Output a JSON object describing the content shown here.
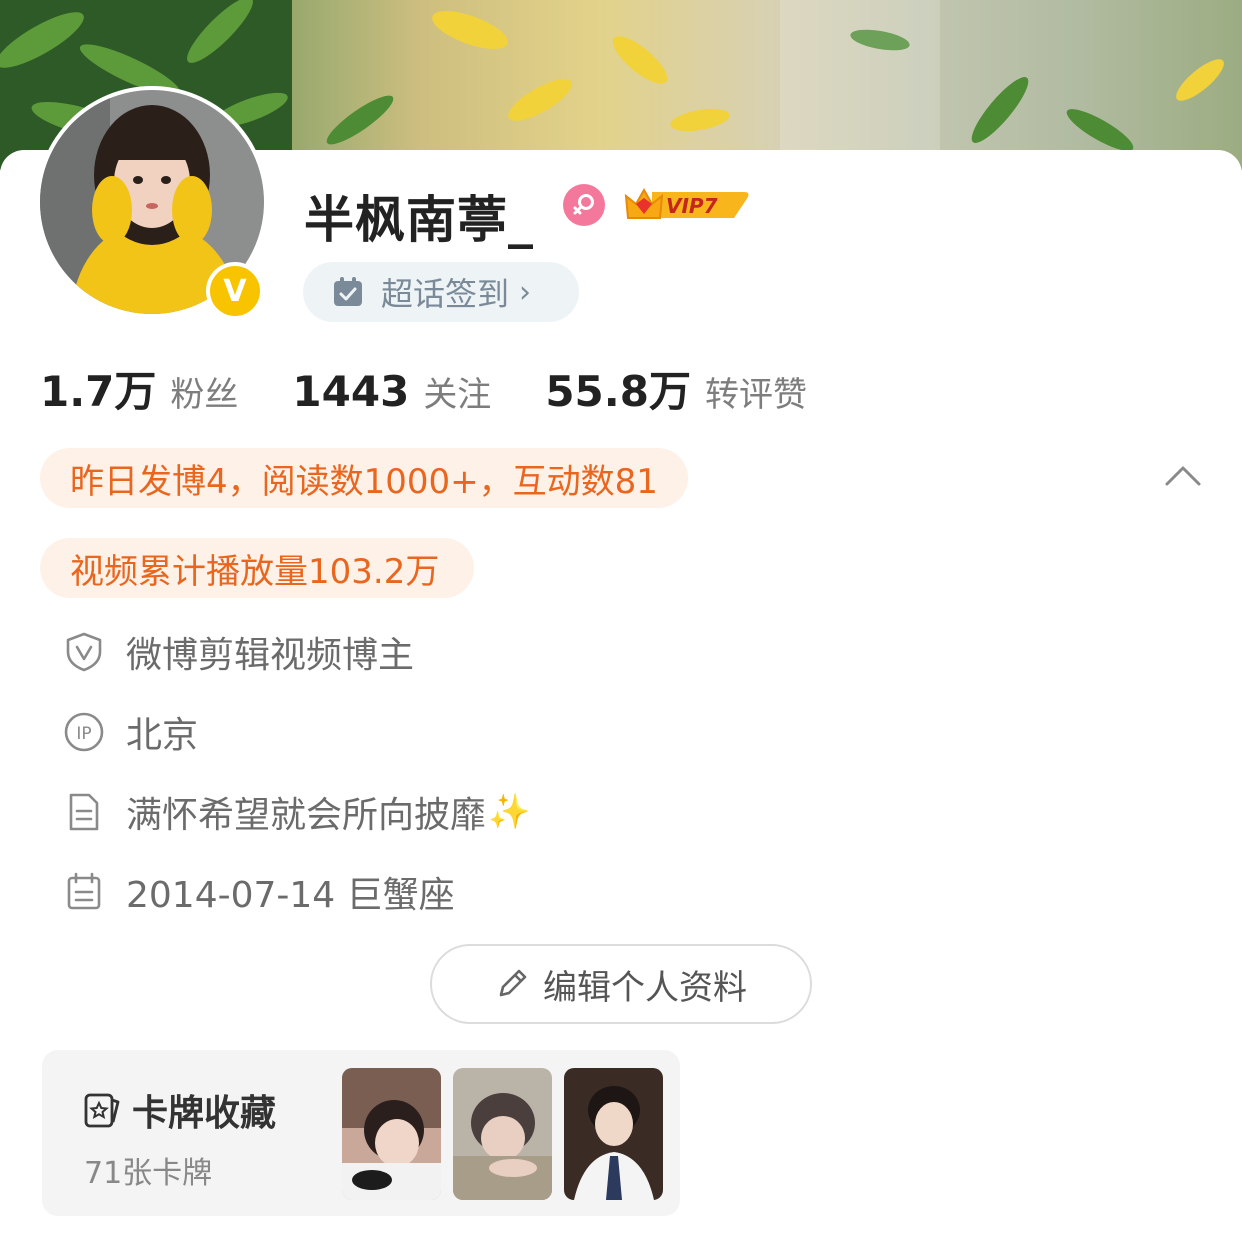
{
  "profile": {
    "name": "半枫南葶_",
    "vip_label": "VIP7",
    "verified_mark": "V",
    "chaohua_label": "超话签到",
    "chaohua_arrow": "›"
  },
  "stats": [
    {
      "value": "1.7万",
      "label": "粉丝"
    },
    {
      "value": "1443",
      "label": "关注"
    },
    {
      "value": "55.8万",
      "label": "转评赞"
    }
  ],
  "highlights": {
    "daily": "昨日发博4，阅读数1000+，互动数81",
    "video": "视频累计播放量103.2万"
  },
  "info": {
    "certification": "微博剪辑视频博主",
    "ip": "北京",
    "bio": "满怀希望就会所向披靡",
    "bio_emoji": "✨",
    "birthday": "2014-07-14 巨蟹座"
  },
  "edit_button": "编辑个人资料",
  "card_collection": {
    "title": "卡牌收藏",
    "count": "71张卡牌"
  },
  "colors": {
    "accent_orange": "#e9661f",
    "pill_bg": "#fdf1e8",
    "verified_yellow": "#f8c400",
    "gender_pink": "#f4789c"
  }
}
